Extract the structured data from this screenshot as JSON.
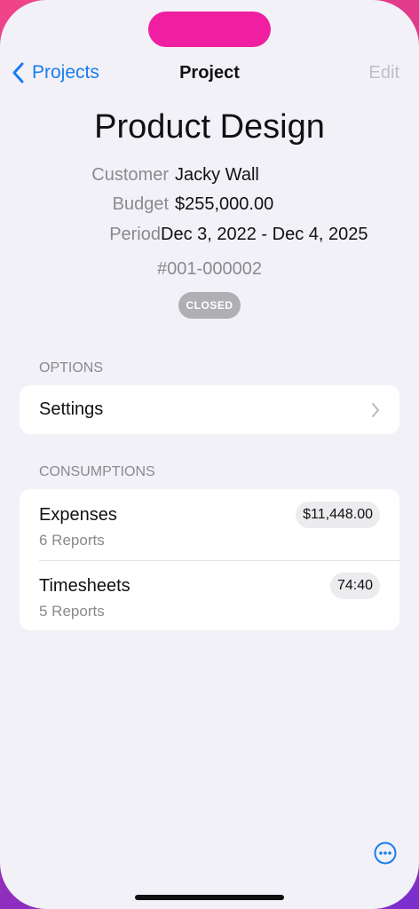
{
  "nav": {
    "back_label": "Projects",
    "title": "Project",
    "edit_label": "Edit"
  },
  "project": {
    "name": "Product Design",
    "customer_label": "Customer",
    "customer": "Jacky Wall",
    "budget_label": "Budget",
    "budget": "$255,000.00",
    "period_label": "Period",
    "period": "Dec 3, 2022 - Dec 4, 2025",
    "code": "#001-000002",
    "status": "CLOSED"
  },
  "options": {
    "header": "OPTIONS",
    "settings_label": "Settings"
  },
  "consumptions": {
    "header": "CONSUMPTIONS",
    "items": [
      {
        "title": "Expenses",
        "subtitle": "6 Reports",
        "value": "$11,448.00"
      },
      {
        "title": "Timesheets",
        "subtitle": "5 Reports",
        "value": "74:40"
      }
    ]
  },
  "icons": {
    "back": "chevron-left-icon",
    "settings": "chevron-right-icon",
    "more": "ellipsis-circle-icon"
  },
  "colors": {
    "accent": "#1a7cf0",
    "background": "#f2f1f7",
    "badge": "#b0b0b4"
  }
}
